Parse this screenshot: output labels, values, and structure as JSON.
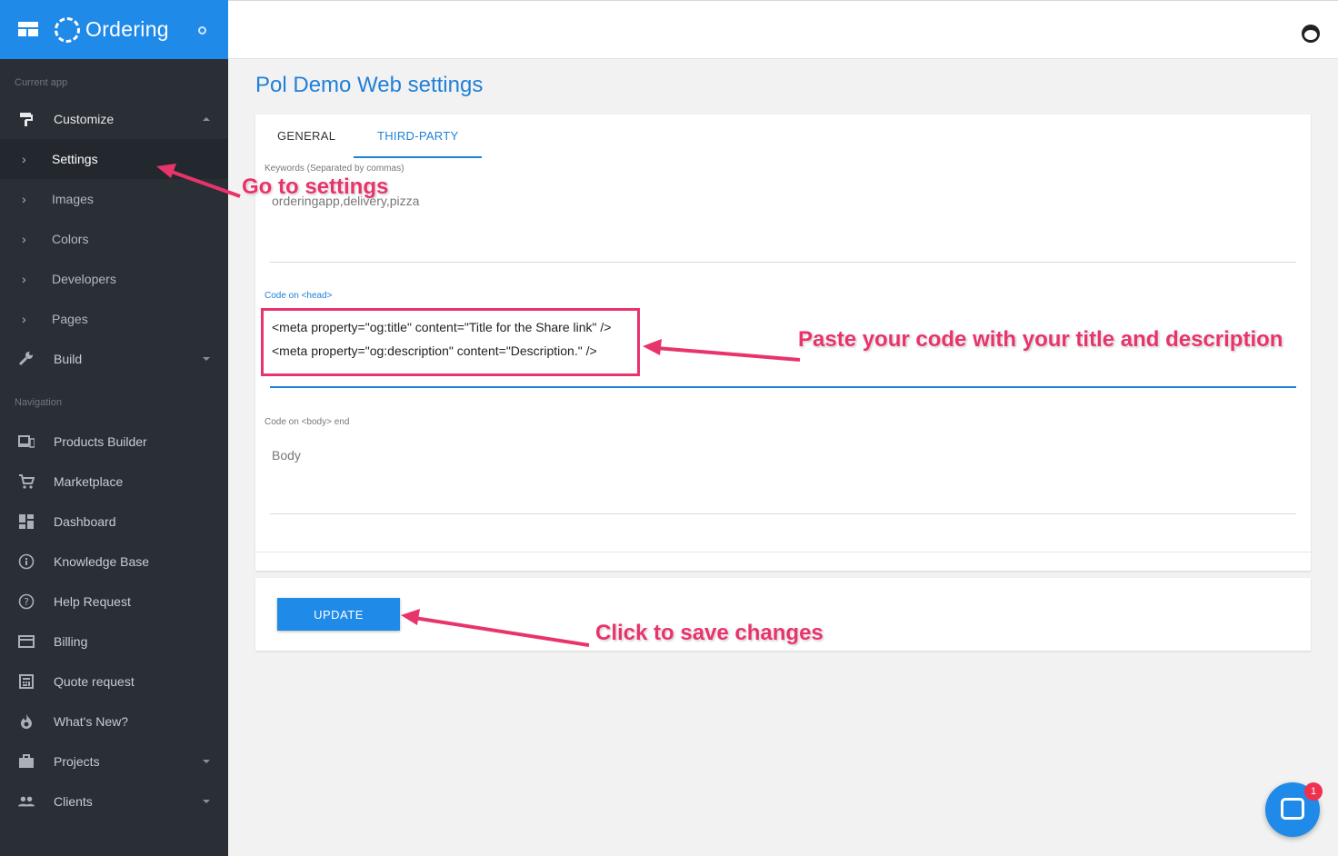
{
  "app": {
    "brand": "Ordering"
  },
  "sidebar": {
    "section_current": "Current app",
    "customize": "Customize",
    "subitems": [
      "Settings",
      "Images",
      "Colors",
      "Developers",
      "Pages"
    ],
    "build": "Build",
    "section_nav": "Navigation",
    "nav": [
      "Products Builder",
      "Marketplace",
      "Dashboard",
      "Knowledge Base",
      "Help Request",
      "Billing",
      "Quote request",
      "What's New?",
      "Projects",
      "Clients"
    ]
  },
  "main": {
    "title": "Pol Demo Web settings",
    "tabs": [
      "GENERAL",
      "THIRD-PARTY"
    ],
    "keywords": {
      "label": "Keywords (Separated by commas)",
      "value": "orderingapp,delivery,pizza"
    },
    "head_code": {
      "label": "Code on <head>",
      "lines": [
        "<meta property=\"og:title\" content=\"Title for the Share link\" />",
        "<meta property=\"og:description\" content=\"Description.\" />"
      ]
    },
    "body_code": {
      "label": "Code on <body> end",
      "placeholder": "Body"
    },
    "update_label": "UPDATE"
  },
  "annotations": {
    "settings": "Go to settings",
    "paste": "Paste your code with your title and description",
    "save": "Click to save changes"
  },
  "chat": {
    "badge": "1"
  },
  "colors": {
    "accent": "#1f8ae8",
    "sidebar": "#2a2f36",
    "annotation": "#e8336b"
  }
}
